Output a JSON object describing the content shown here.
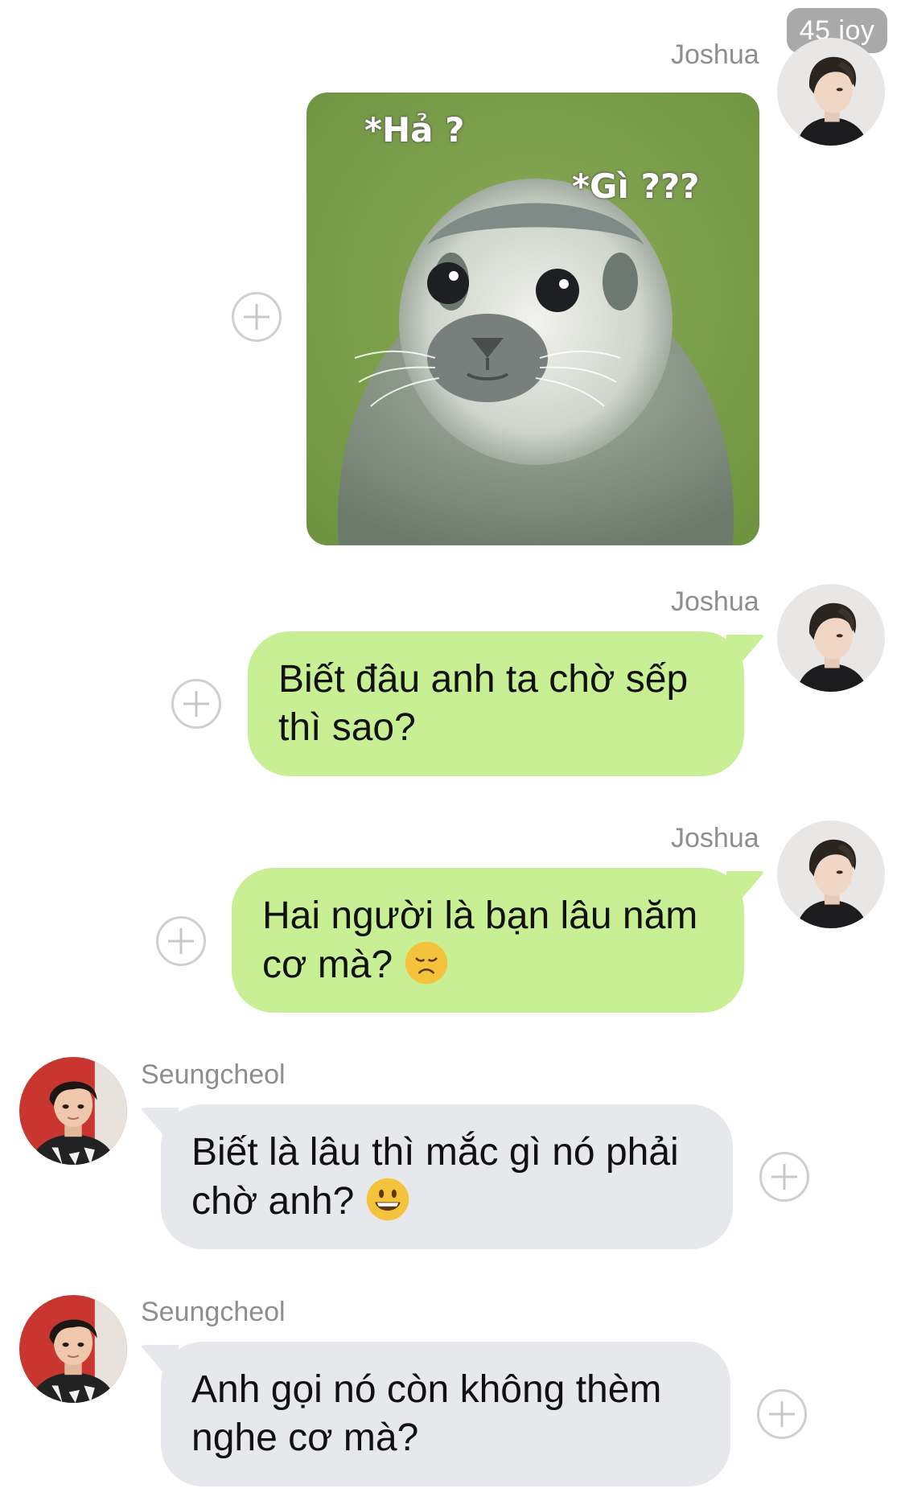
{
  "status_badge": "45 joy",
  "messages": [
    {
      "sender": "Joshua",
      "type": "sticker",
      "sticker": {
        "caption_1": "*Hả ?",
        "caption_2": "*Gì ???"
      }
    },
    {
      "sender": "Joshua",
      "type": "text",
      "lines": [
        "Biết đâu anh ta chờ sếp",
        "thì sao?"
      ]
    },
    {
      "sender": "Joshua",
      "type": "text",
      "lines": [
        "Hai người là bạn lâu năm",
        "cơ mà?"
      ],
      "emoji": "disappointed-face-emoji"
    },
    {
      "sender": "Seungcheol",
      "type": "text",
      "lines": [
        "Biết là lâu thì mắc gì nó phải",
        "chờ anh?"
      ],
      "emoji": "grinning-face-emoji"
    },
    {
      "sender": "Seungcheol",
      "type": "text",
      "lines": [
        "Anh gọi nó còn không thèm",
        "nghe cơ mà?"
      ]
    }
  ],
  "icons": {
    "add_reaction": "plus-circle-icon"
  },
  "colors": {
    "outgoing_bubble": "#c9ef94",
    "incoming_bubble": "#e6e8ec",
    "sender_name": "#8e8e8e",
    "badge_bg": "#969696"
  }
}
